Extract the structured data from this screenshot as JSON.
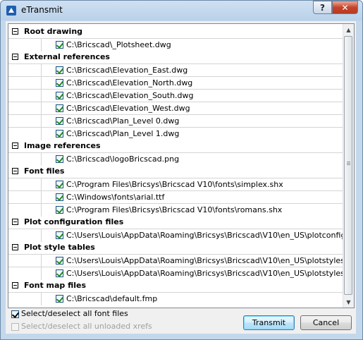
{
  "window": {
    "title": "eTransmit",
    "help_glyph": "?",
    "close_glyph": "✕"
  },
  "categories": [
    {
      "label": "Root drawing",
      "items": [
        {
          "path": "C:\\Bricscad\\_Plotsheet.dwg",
          "checked": true
        }
      ]
    },
    {
      "label": "External references",
      "items": [
        {
          "path": "C:\\Bricscad\\Elevation_East.dwg",
          "checked": true
        },
        {
          "path": "C:\\Bricscad\\Elevation_North.dwg",
          "checked": true
        },
        {
          "path": "C:\\Bricscad\\Elevation_South.dwg",
          "checked": true
        },
        {
          "path": "C:\\Bricscad\\Elevation_West.dwg",
          "checked": true
        },
        {
          "path": "C:\\Bricscad\\Plan_Level 0.dwg",
          "checked": true
        },
        {
          "path": "C:\\Bricscad\\Plan_Level 1.dwg",
          "checked": true
        }
      ]
    },
    {
      "label": "Image references",
      "items": [
        {
          "path": "C:\\Bricscad\\logoBricscad.png",
          "checked": true
        }
      ]
    },
    {
      "label": "Font files",
      "items": [
        {
          "path": "C:\\Program Files\\Bricsys\\Bricscad V10\\fonts\\simplex.shx",
          "checked": true
        },
        {
          "path": "C:\\Windows\\fonts\\arial.ttf",
          "checked": true
        },
        {
          "path": "C:\\Program Files\\Bricsys\\Bricscad V10\\fonts\\romans.shx",
          "checked": true
        }
      ]
    },
    {
      "label": "Plot configuration files",
      "items": [
        {
          "path": "C:\\Users\\Louis\\AppData\\Roaming\\Bricsys\\Bricscad\\V10\\en_US\\plotconfig\\Canon",
          "checked": true
        }
      ]
    },
    {
      "label": "Plot style tables",
      "items": [
        {
          "path": "C:\\Users\\Louis\\AppData\\Roaming\\Bricsys\\Bricscad\\V10\\en_US\\plotstyles\\MonoCh",
          "checked": true
        },
        {
          "path": "C:\\Users\\Louis\\AppData\\Roaming\\Bricsys\\Bricscad\\V10\\en_US\\plotstyles\\Bricscad",
          "checked": true
        }
      ]
    },
    {
      "label": "Font map files",
      "items": [
        {
          "path": "C:\\Bricscad\\default.fmp",
          "checked": true
        }
      ]
    }
  ],
  "scrollbar": {
    "up_glyph": "▲",
    "down_glyph": "▼"
  },
  "options": {
    "select_fonts": {
      "label": "Select/deselect all font files",
      "checked": true,
      "enabled": true
    },
    "select_xrefs": {
      "label": "Select/deselect all unloaded xrefs",
      "checked": false,
      "enabled": false
    }
  },
  "buttons": {
    "transmit": "Transmit",
    "cancel": "Cancel"
  },
  "colors": {
    "titlebar": "#b9d1ea",
    "close_button": "#c7432a",
    "checkmark": "#218a21",
    "default_button_border": "#3c7fb1"
  }
}
